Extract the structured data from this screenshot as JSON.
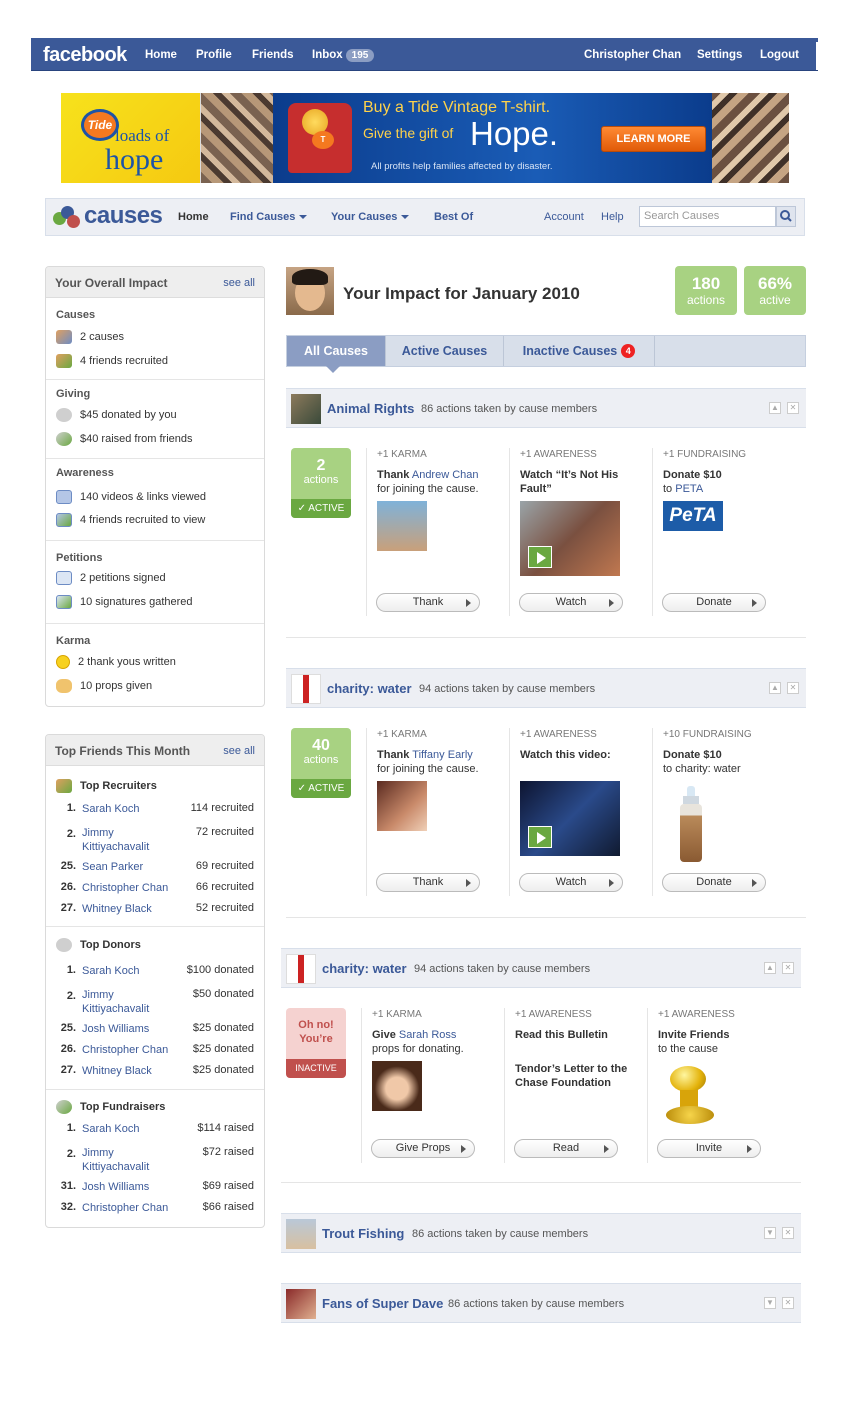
{
  "fb": {
    "logo": "facebook",
    "nav": [
      "Home",
      "Profile",
      "Friends",
      "Inbox"
    ],
    "inbox_count": "195",
    "user": "Christopher Chan",
    "settings": "Settings",
    "logout": "Logout"
  },
  "ad": {
    "brand": "Tide",
    "slogan1": "loads of",
    "slogan2": "hope",
    "line1": "Buy a Tide Vintage T-shirt.",
    "line2": "Give the gift of",
    "line3": "Hope.",
    "line4": "All profits help families affected by disaster.",
    "cta": "LEARN MORE"
  },
  "causes_nav": {
    "logo": "causes",
    "home": "Home",
    "find": "Find Causes",
    "your": "Your Causes",
    "best": "Best Of",
    "account": "Account",
    "help": "Help",
    "search_placeholder": "Search Causes"
  },
  "impact": {
    "title": "Your Overall Impact",
    "see_all": "see all",
    "causes_h": "Causes",
    "causes": [
      "2 causes",
      "4 friends recruited"
    ],
    "giving_h": "Giving",
    "giving": [
      "$45 donated by you",
      "$40 raised from friends"
    ],
    "awareness_h": "Awareness",
    "awareness": [
      "140 videos & links viewed",
      "4 friends recruited to view"
    ],
    "petitions_h": "Petitions",
    "petitions": [
      "2 petitions signed",
      "10 signatures gathered"
    ],
    "karma_h": "Karma",
    "karma": [
      "2 thank yous written",
      "10 props given"
    ]
  },
  "top_friends": {
    "title": "Top Friends This Month",
    "see_all": "see all",
    "recruiters_h": "Top Recruiters",
    "recruiters": [
      {
        "rank": "1.",
        "name": "Sarah Koch",
        "val": "114 recruited"
      },
      {
        "rank": "2.",
        "name": "Jimmy Kittiyachavalit",
        "val": "72 recruited"
      },
      {
        "rank": "25.",
        "name": "Sean Parker",
        "val": "69 recruited"
      },
      {
        "rank": "26.",
        "name": "Christopher Chan",
        "val": "66 recruited"
      },
      {
        "rank": "27.",
        "name": "Whitney Black",
        "val": "52 recruited"
      }
    ],
    "donors_h": "Top Donors",
    "donors": [
      {
        "rank": "1.",
        "name": "Sarah Koch",
        "val": "$100 donated"
      },
      {
        "rank": "2.",
        "name": "Jimmy Kittiyachavalit",
        "val": "$50 donated"
      },
      {
        "rank": "25.",
        "name": "Josh Williams",
        "val": "$25 donated"
      },
      {
        "rank": "26.",
        "name": "Christopher Chan",
        "val": "$25 donated"
      },
      {
        "rank": "27.",
        "name": "Whitney Black",
        "val": "$25 donated"
      }
    ],
    "fundraisers_h": "Top Fundraisers",
    "fundraisers": [
      {
        "rank": "1.",
        "name": "Sarah Koch",
        "val": "$114 raised"
      },
      {
        "rank": "2.",
        "name": "Jimmy Kittiyachavalit",
        "val": "$72 raised"
      },
      {
        "rank": "31.",
        "name": "Josh Williams",
        "val": "$69 raised"
      },
      {
        "rank": "32.",
        "name": "Christopher Chan",
        "val": "$66 raised"
      }
    ]
  },
  "main": {
    "title": "Your Impact for January 2010",
    "actions_n": "180",
    "actions_l": "actions",
    "active_n": "66%",
    "active_l": "active",
    "tabs": [
      "All Causes",
      "Active Causes",
      "Inactive Causes"
    ],
    "inactive_count": "4"
  },
  "causes": [
    {
      "name": "Animal Rights",
      "meta": "86 actions taken by cause members",
      "badge_n": "2",
      "badge_l": "actions",
      "badge_s": "ACTIVE",
      "c1_cat": "+1 KARMA",
      "c1_a": "Thank",
      "c1_link": "Andrew Chan",
      "c1_b": "for joining the cause.",
      "c1_btn": "Thank",
      "c2_cat": "+1 AWARENESS",
      "c2_a": "Watch “It’s Not His Fault”",
      "c2_btn": "Watch",
      "c3_cat": "+1 FUNDRAISING",
      "c3_a": "Donate $10",
      "c3_b": "to",
      "c3_link": "PETA",
      "c3_logo": "PeTA",
      "c3_btn": "Donate"
    },
    {
      "name": "charity: water",
      "meta": "94 actions taken by cause members",
      "badge_n": "40",
      "badge_l": "actions",
      "badge_s": "ACTIVE",
      "c1_cat": "+1 KARMA",
      "c1_a": "Thank",
      "c1_link": "Tiffany Early",
      "c1_b": "for joining the cause.",
      "c1_btn": "Thank",
      "c2_cat": "+1 AWARENESS",
      "c2_a": "Watch this video:",
      "c2_btn": "Watch",
      "c3_cat": "+10 FUNDRAISING",
      "c3_a": "Donate $10",
      "c3_b": "to charity: water",
      "c3_btn": "Donate"
    },
    {
      "name": "charity: water",
      "meta": "94 actions taken by cause members",
      "badge_n": "Oh no! You’re",
      "badge_s": "INACTIVE",
      "c1_cat": "+1 KARMA",
      "c1_a": "Give",
      "c1_link": "Sarah Ross",
      "c1_b": "props for donating.",
      "c1_btn": "Give Props",
      "c2_cat": "+1 AWARENESS",
      "c2_a": "Read this Bulletin",
      "c2_link": "Tendor’s Letter to the Chase Foundation",
      "c2_btn": "Read",
      "c3_cat": "+1 AWARENESS",
      "c3_a": "Invite Friends",
      "c3_b": "to the cause",
      "c3_btn": "Invite"
    },
    {
      "name": "Trout Fishing",
      "meta": "86 actions taken by cause members"
    },
    {
      "name": "Fans of Super Dave",
      "meta": "86 actions taken by cause members"
    }
  ]
}
